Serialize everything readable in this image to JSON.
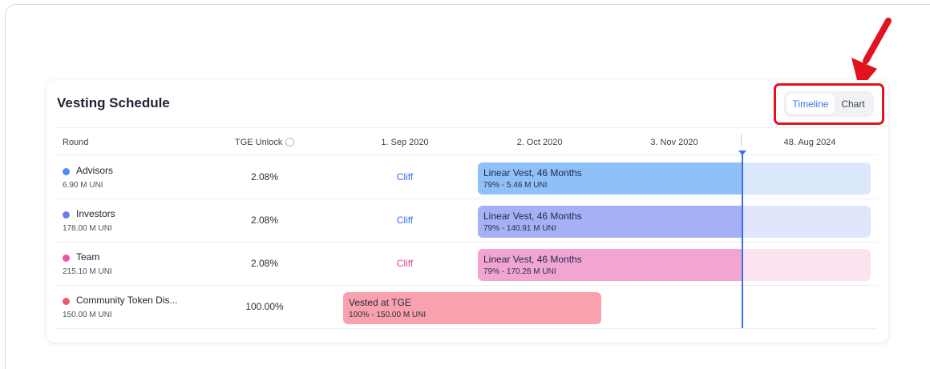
{
  "card": {
    "title": "Vesting Schedule"
  },
  "view_toggle": {
    "active": "Timeline",
    "inactive": "Chart"
  },
  "columns": {
    "round": "Round",
    "tge_unlock": "TGE Unlock",
    "date1": "1. Sep 2020",
    "date2": "2. Oct 2020",
    "date3": "3. Nov 2020",
    "today": "48. Aug 2024"
  },
  "rows": [
    {
      "name": "Advisors",
      "amount": "6.90 M UNI",
      "tge": "2.08%",
      "cliff": "Cliff",
      "bar_title": "Linear Vest, 46 Months",
      "bar_sub": "79% - 5.46 M UNI",
      "dot_color": "#4b8df0",
      "cliff_color": "#3d6ff5",
      "bar_color": "#8fc0f7",
      "tail_color": "#dbe8fc"
    },
    {
      "name": "Investors",
      "amount": "178.00 M UNI",
      "tge": "2.08%",
      "cliff": "Cliff",
      "bar_title": "Linear Vest, 46 Months",
      "bar_sub": "79% - 140.91 M UNI",
      "dot_color": "#6f7ce8",
      "cliff_color": "#3d6ff5",
      "bar_color": "#a5b1f4",
      "tail_color": "#e2e6fc"
    },
    {
      "name": "Team",
      "amount": "215.10 M UNI",
      "tge": "2.08%",
      "cliff": "Cliff",
      "bar_title": "Linear Vest, 46 Months",
      "bar_sub": "79% - 170.28 M UNI",
      "dot_color": "#e45aa6",
      "cliff_color": "#e2478f",
      "bar_color": "#f3a5d2",
      "tail_color": "#fbe3f0"
    },
    {
      "name": "Community Token Dis...",
      "amount": "150.00 M UNI",
      "tge": "100.00%",
      "cliff": "",
      "bar_title": "Vested at TGE",
      "bar_sub": "100% - 150.00 M UNI",
      "dot_color": "#ea5a72",
      "cliff_color": "#3d6ff5",
      "bar_color": "#f9a1ac",
      "tail_color": ""
    }
  ]
}
